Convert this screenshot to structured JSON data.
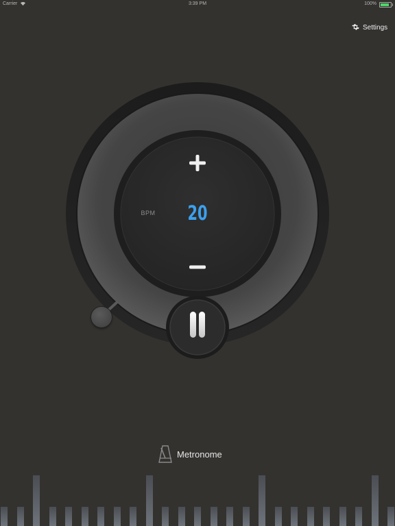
{
  "status_bar": {
    "carrier": "Carrier",
    "time": "3:39 PM",
    "battery": "100%",
    "battery_level": 1.0
  },
  "settings": {
    "label": "Settings",
    "icon": "gear-icon"
  },
  "tempo": {
    "label": "BPM",
    "value": "20",
    "increase_icon": "plus-icon",
    "decrease_icon": "minus-icon"
  },
  "transport": {
    "icon": "pause-icon",
    "state": "playing"
  },
  "footer": {
    "title": "Metronome",
    "icon": "metronome-icon"
  },
  "beat_bars": [
    {
      "accent": false
    },
    {
      "accent": false
    },
    {
      "accent": true
    },
    {
      "accent": false
    },
    {
      "accent": false
    },
    {
      "accent": false
    },
    {
      "accent": false
    },
    {
      "accent": false
    },
    {
      "accent": false
    },
    {
      "accent": true
    },
    {
      "accent": false
    },
    {
      "accent": false
    },
    {
      "accent": false
    },
    {
      "accent": false
    },
    {
      "accent": false
    },
    {
      "accent": false
    },
    {
      "accent": true
    },
    {
      "accent": false
    },
    {
      "accent": false
    },
    {
      "accent": false
    },
    {
      "accent": false
    },
    {
      "accent": false
    },
    {
      "accent": false
    },
    {
      "accent": true
    },
    {
      "accent": false
    }
  ],
  "colors": {
    "background": "#33322f",
    "accent": "#3ca0ee",
    "battery": "#4cd964"
  }
}
